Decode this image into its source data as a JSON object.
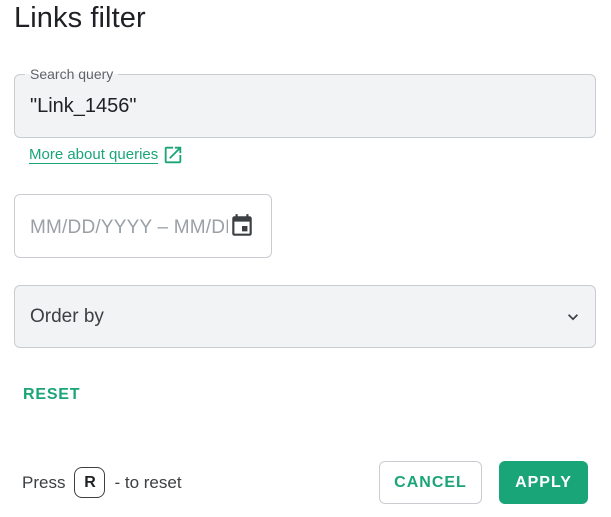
{
  "dialog": {
    "title": "Links filter"
  },
  "search": {
    "label": "Search query",
    "value": "\"Link_1456\""
  },
  "more_link": {
    "label": "More about queries",
    "icon": "external-link-icon"
  },
  "date_range": {
    "placeholder": "MM/DD/YYYY – MM/DD/YYYY",
    "icon": "calendar-icon"
  },
  "order_by": {
    "label": "Order by",
    "icon": "chevron-down-icon"
  },
  "actions": {
    "reset_label": "RESET",
    "cancel_label": "CANCEL",
    "apply_label": "APPLY"
  },
  "hint": {
    "prefix": "Press",
    "key": "R",
    "suffix": "- to reset"
  },
  "colors": {
    "accent": "#1aa579",
    "field_background": "#f1f3f4",
    "border": "#c9cdd1"
  }
}
